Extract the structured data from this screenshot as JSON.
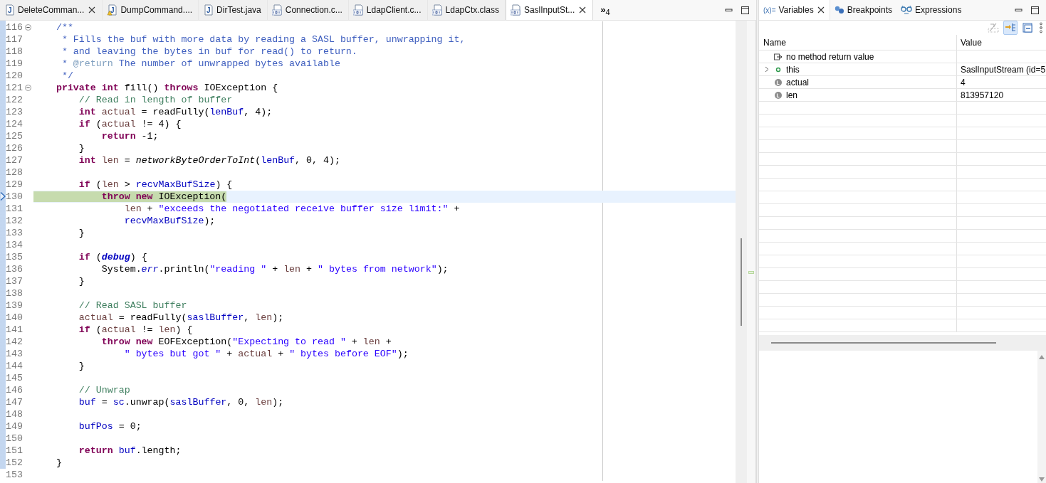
{
  "editor": {
    "tabs": [
      {
        "label": "DeleteComman...",
        "kind": "java",
        "icon_text": "J",
        "selected": false,
        "closable": true,
        "warning": false
      },
      {
        "label": "DumpCommand....",
        "kind": "java",
        "icon_text": "J",
        "selected": false,
        "closable": false,
        "warning": true
      },
      {
        "label": "DirTest.java",
        "kind": "java",
        "icon_text": "J",
        "selected": false,
        "closable": false,
        "warning": false
      },
      {
        "label": "Connection.c...",
        "kind": "class",
        "selected": false,
        "closable": false,
        "warning": false
      },
      {
        "label": "LdapClient.c...",
        "kind": "class",
        "selected": false,
        "closable": false,
        "warning": false
      },
      {
        "label": "LdapCtx.class",
        "kind": "class",
        "selected": false,
        "closable": false,
        "warning": false
      },
      {
        "label": "SaslInputSt...",
        "kind": "class",
        "selected": true,
        "closable": true,
        "warning": false
      }
    ],
    "overflow": {
      "chevron": "»",
      "count": "4"
    },
    "lines": [
      {
        "number": "116",
        "fold": true,
        "current": false,
        "tokens": [
          {
            "kind": "javadoc",
            "text": "    /**"
          }
        ]
      },
      {
        "number": "117",
        "fold": false,
        "current": false,
        "tokens": [
          {
            "kind": "javadoc",
            "text": "     * Fills the buf with more data by reading a SASL buffer, unwrapping it,"
          }
        ]
      },
      {
        "number": "118",
        "fold": false,
        "current": false,
        "tokens": [
          {
            "kind": "javadoc",
            "text": "     * and leaving the bytes in buf for read() to return."
          }
        ]
      },
      {
        "number": "119",
        "fold": false,
        "current": false,
        "tokens": [
          {
            "kind": "javadoc",
            "text": "     * "
          },
          {
            "kind": "javadoc-tag",
            "text": "@return"
          },
          {
            "kind": "javadoc",
            "text": " The number of unwrapped bytes available"
          }
        ]
      },
      {
        "number": "120",
        "fold": false,
        "current": false,
        "tokens": [
          {
            "kind": "javadoc",
            "text": "     */"
          }
        ]
      },
      {
        "number": "121",
        "fold": true,
        "current": false,
        "tokens": [
          {
            "kind": "keyword",
            "text": "    private"
          },
          {
            "kind": "keyword",
            "text": " int"
          },
          {
            "kind": "plain",
            "text": " fill() "
          },
          {
            "kind": "keyword",
            "text": "throws"
          },
          {
            "kind": "plain",
            "text": " IOException {"
          }
        ]
      },
      {
        "number": "122",
        "fold": false,
        "current": false,
        "tokens": [
          {
            "kind": "comment",
            "text": "        // Read in length of buffer"
          }
        ]
      },
      {
        "number": "123",
        "fold": false,
        "current": false,
        "tokens": [
          {
            "kind": "keyword",
            "text": "        int"
          },
          {
            "kind": "local",
            "text": " actual"
          },
          {
            "kind": "plain",
            "text": " = readFully("
          },
          {
            "kind": "field",
            "text": "lenBuf"
          },
          {
            "kind": "plain",
            "text": ", 4);"
          }
        ]
      },
      {
        "number": "124",
        "fold": false,
        "current": false,
        "tokens": [
          {
            "kind": "keyword",
            "text": "        if"
          },
          {
            "kind": "plain",
            "text": " ("
          },
          {
            "kind": "local",
            "text": "actual"
          },
          {
            "kind": "plain",
            "text": " != 4) {"
          }
        ]
      },
      {
        "number": "125",
        "fold": false,
        "current": false,
        "tokens": [
          {
            "kind": "keyword",
            "text": "            return"
          },
          {
            "kind": "plain",
            "text": " -1;"
          }
        ]
      },
      {
        "number": "126",
        "fold": false,
        "current": false,
        "tokens": [
          {
            "kind": "plain",
            "text": "        }"
          }
        ]
      },
      {
        "number": "127",
        "fold": false,
        "current": false,
        "tokens": [
          {
            "kind": "keyword",
            "text": "        int"
          },
          {
            "kind": "local",
            "text": " len"
          },
          {
            "kind": "plain",
            "text": " = "
          },
          {
            "kind": "static-method",
            "text": "networkByteOrderToInt"
          },
          {
            "kind": "plain",
            "text": "("
          },
          {
            "kind": "field",
            "text": "lenBuf"
          },
          {
            "kind": "plain",
            "text": ", 0, 4);"
          }
        ]
      },
      {
        "number": "128",
        "fold": false,
        "current": false
      },
      {
        "number": "129",
        "fold": false,
        "current": false,
        "tokens": [
          {
            "kind": "keyword",
            "text": "        if"
          },
          {
            "kind": "plain",
            "text": " ("
          },
          {
            "kind": "local",
            "text": "len"
          },
          {
            "kind": "plain",
            "text": " > "
          },
          {
            "kind": "field",
            "text": "recvMaxBufSize"
          },
          {
            "kind": "plain",
            "text": ") {"
          }
        ]
      },
      {
        "number": "130",
        "fold": false,
        "current": true,
        "tokens": [
          {
            "kind": "keyword",
            "text": "            throw"
          },
          {
            "kind": "keyword",
            "text": " new"
          },
          {
            "kind": "plain",
            "text": " IOException("
          }
        ]
      },
      {
        "number": "131",
        "fold": false,
        "current": false,
        "tokens": [
          {
            "kind": "local",
            "text": "                len"
          },
          {
            "kind": "plain",
            "text": " + "
          },
          {
            "kind": "string",
            "text": "\"exceeds the negotiated receive buffer size limit:\""
          },
          {
            "kind": "plain",
            "text": " +"
          }
        ]
      },
      {
        "number": "132",
        "fold": false,
        "current": false,
        "tokens": [
          {
            "kind": "field",
            "text": "                recvMaxBufSize"
          },
          {
            "kind": "plain",
            "text": ");"
          }
        ]
      },
      {
        "number": "133",
        "fold": false,
        "current": false,
        "tokens": [
          {
            "kind": "plain",
            "text": "        }"
          }
        ]
      },
      {
        "number": "134",
        "fold": false,
        "current": false
      },
      {
        "number": "135",
        "fold": false,
        "current": false,
        "tokens": [
          {
            "kind": "keyword",
            "text": "        if"
          },
          {
            "kind": "plain",
            "text": " ("
          },
          {
            "kind": "constant",
            "text": "debug"
          },
          {
            "kind": "plain",
            "text": ") {"
          }
        ]
      },
      {
        "number": "136",
        "fold": false,
        "current": false,
        "tokens": [
          {
            "kind": "plain",
            "text": "            System."
          },
          {
            "kind": "static-field",
            "text": "err"
          },
          {
            "kind": "plain",
            "text": ".println("
          },
          {
            "kind": "string",
            "text": "\"reading \""
          },
          {
            "kind": "plain",
            "text": " + "
          },
          {
            "kind": "local",
            "text": "len"
          },
          {
            "kind": "plain",
            "text": " + "
          },
          {
            "kind": "string",
            "text": "\" bytes from network\""
          },
          {
            "kind": "plain",
            "text": ");"
          }
        ]
      },
      {
        "number": "137",
        "fold": false,
        "current": false,
        "tokens": [
          {
            "kind": "plain",
            "text": "        }"
          }
        ]
      },
      {
        "number": "138",
        "fold": false,
        "current": false
      },
      {
        "number": "139",
        "fold": false,
        "current": false,
        "tokens": [
          {
            "kind": "comment",
            "text": "        // Read SASL buffer"
          }
        ]
      },
      {
        "number": "140",
        "fold": false,
        "current": false,
        "tokens": [
          {
            "kind": "local",
            "text": "        actual"
          },
          {
            "kind": "plain",
            "text": " = readFully("
          },
          {
            "kind": "field",
            "text": "saslBuffer"
          },
          {
            "kind": "plain",
            "text": ", "
          },
          {
            "kind": "local",
            "text": "len"
          },
          {
            "kind": "plain",
            "text": ");"
          }
        ]
      },
      {
        "number": "141",
        "fold": false,
        "current": false,
        "tokens": [
          {
            "kind": "keyword",
            "text": "        if"
          },
          {
            "kind": "plain",
            "text": " ("
          },
          {
            "kind": "local",
            "text": "actual"
          },
          {
            "kind": "plain",
            "text": " != "
          },
          {
            "kind": "local",
            "text": "len"
          },
          {
            "kind": "plain",
            "text": ") {"
          }
        ]
      },
      {
        "number": "142",
        "fold": false,
        "current": false,
        "tokens": [
          {
            "kind": "keyword",
            "text": "            throw"
          },
          {
            "kind": "keyword",
            "text": " new"
          },
          {
            "kind": "plain",
            "text": " EOFException("
          },
          {
            "kind": "string",
            "text": "\"Expecting to read \""
          },
          {
            "kind": "plain",
            "text": " + "
          },
          {
            "kind": "local",
            "text": "len"
          },
          {
            "kind": "plain",
            "text": " +"
          }
        ]
      },
      {
        "number": "143",
        "fold": false,
        "current": false,
        "tokens": [
          {
            "kind": "string",
            "text": "                \" bytes but got \""
          },
          {
            "kind": "plain",
            "text": " + "
          },
          {
            "kind": "local",
            "text": "actual"
          },
          {
            "kind": "plain",
            "text": " + "
          },
          {
            "kind": "string",
            "text": "\" bytes before EOF\""
          },
          {
            "kind": "plain",
            "text": ");"
          }
        ]
      },
      {
        "number": "144",
        "fold": false,
        "current": false,
        "tokens": [
          {
            "kind": "plain",
            "text": "        }"
          }
        ]
      },
      {
        "number": "145",
        "fold": false,
        "current": false
      },
      {
        "number": "146",
        "fold": false,
        "current": false,
        "tokens": [
          {
            "kind": "comment",
            "text": "        // Unwrap"
          }
        ]
      },
      {
        "number": "147",
        "fold": false,
        "current": false,
        "tokens": [
          {
            "kind": "field",
            "text": "        buf"
          },
          {
            "kind": "plain",
            "text": " = "
          },
          {
            "kind": "field",
            "text": "sc"
          },
          {
            "kind": "plain",
            "text": ".unwrap("
          },
          {
            "kind": "field",
            "text": "saslBuffer"
          },
          {
            "kind": "plain",
            "text": ", 0, "
          },
          {
            "kind": "local",
            "text": "len"
          },
          {
            "kind": "plain",
            "text": ");"
          }
        ]
      },
      {
        "number": "148",
        "fold": false,
        "current": false
      },
      {
        "number": "149",
        "fold": false,
        "current": false,
        "tokens": [
          {
            "kind": "field",
            "text": "        bufPos"
          },
          {
            "kind": "plain",
            "text": " = 0;"
          }
        ]
      },
      {
        "number": "150",
        "fold": false,
        "current": false
      },
      {
        "number": "151",
        "fold": false,
        "current": false,
        "tokens": [
          {
            "kind": "keyword",
            "text": "        return"
          },
          {
            "kind": "field",
            "text": " buf"
          },
          {
            "kind": "plain",
            "text": ".length;"
          }
        ]
      },
      {
        "number": "152",
        "fold": false,
        "current": false,
        "tokens": [
          {
            "kind": "plain",
            "text": "    }"
          }
        ]
      },
      {
        "number": "153",
        "fold": false,
        "current": false
      }
    ]
  },
  "variables_view": {
    "tabs": [
      {
        "label": "Variables",
        "icon_text": "(x)=",
        "kind": "variables",
        "selected": true,
        "closable": true
      },
      {
        "label": "Breakpoints",
        "kind": "breakpoints",
        "selected": false,
        "closable": false
      },
      {
        "label": "Expressions",
        "kind": "expressions",
        "selected": false,
        "closable": false
      }
    ],
    "toolbar": [
      {
        "kind": "type-names",
        "pressed": false
      },
      {
        "kind": "show-logical",
        "pressed": true
      },
      {
        "kind": "collapse-all",
        "pressed": false
      },
      {
        "kind": "view-menu",
        "pressed": false
      }
    ],
    "columns": [
      "Name",
      "Value"
    ],
    "rows": [
      {
        "kind": "return",
        "name": "no method return value",
        "has_children": false
      },
      {
        "kind": "object",
        "name": "this",
        "value": "SaslInputStream  (id=5",
        "has_children": true
      },
      {
        "kind": "local",
        "name": "actual",
        "value": "4",
        "has_children": false
      },
      {
        "kind": "local",
        "name": "len",
        "value": "813957120",
        "has_children": false
      }
    ]
  }
}
